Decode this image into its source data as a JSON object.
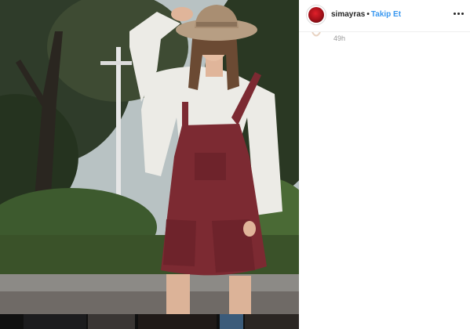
{
  "post": {
    "username": "simayras",
    "separator": "•",
    "follow_label": "Takip Et",
    "timestamp": "49h"
  },
  "icons": {
    "avatar": "profile-avatar",
    "more": "more-options-icon",
    "comment_heart": "heart-icon"
  },
  "colors": {
    "follow_accent": "#3897f0",
    "username": "#262626",
    "timestamp": "#999999"
  }
}
